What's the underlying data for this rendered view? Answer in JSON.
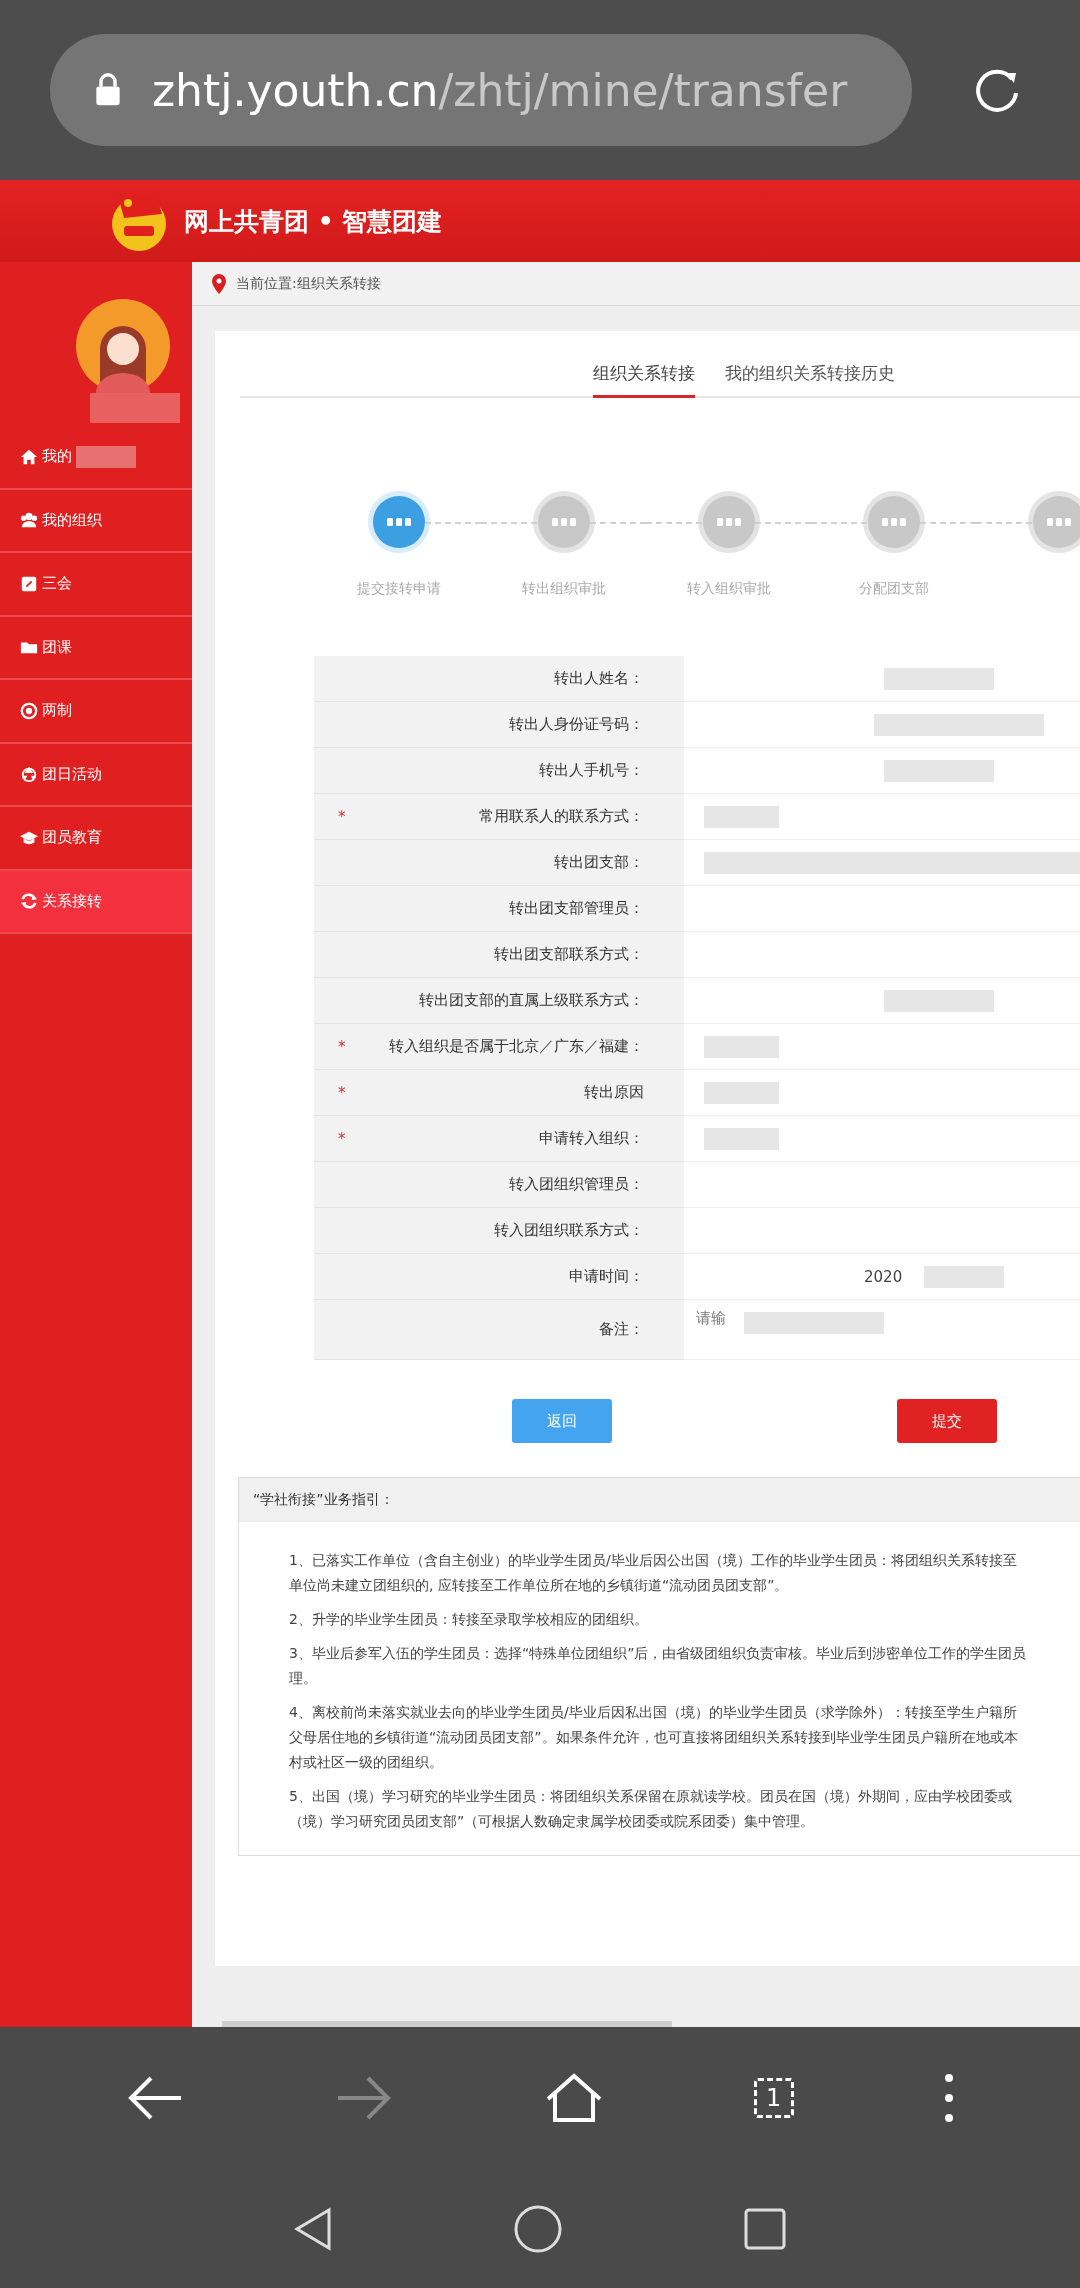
{
  "browser": {
    "url_host": "zhtj.youth.cn",
    "url_path": "/zhtj/mine/transfer",
    "tab_count": "1",
    "forward_disabled": true
  },
  "header": {
    "title": "网上共青团 • 智慧团建"
  },
  "sidebar": {
    "items": [
      {
        "label": "我的",
        "selected": false,
        "blurred": true
      },
      {
        "label": "我的组织",
        "selected": false,
        "blurred": false
      },
      {
        "label": "三会",
        "selected": false,
        "blurred": false
      },
      {
        "label": "团课",
        "selected": false,
        "blurred": false
      },
      {
        "label": "两制",
        "selected": false,
        "blurred": false
      },
      {
        "label": "团日活动",
        "selected": false,
        "blurred": false
      },
      {
        "label": "团员教育",
        "selected": false,
        "blurred": false
      },
      {
        "label": "关系接转",
        "selected": true,
        "blurred": false
      }
    ]
  },
  "breadcrumb": "当前位置:组织关系转接",
  "tabs": [
    {
      "label": "组织关系转接",
      "selected": true
    },
    {
      "label": "我的组织关系转接历史",
      "selected": false
    }
  ],
  "steps": [
    {
      "label": "提交接转申请",
      "active": true
    },
    {
      "label": "转出组织审批",
      "active": false
    },
    {
      "label": "转入组织审批",
      "active": false
    },
    {
      "label": "分配团支部",
      "active": false
    },
    {
      "active": false
    }
  ],
  "form": {
    "rows": [
      {
        "label": "转出人姓名：",
        "blurred": true
      },
      {
        "label": "转出人身份证号码：",
        "blurred": true
      },
      {
        "label": "转出人手机号：",
        "blurred": true
      },
      {
        "mark": "*",
        "label": "常用联系人的联系方式：",
        "blurred": true
      },
      {
        "label": "转出团支部：",
        "blurred": true
      },
      {
        "label": "转出团支部管理员：",
        "blurred": false
      },
      {
        "label": "转出团支部联系方式：",
        "blurred": false
      },
      {
        "label": "转出团支部的直属上级联系方式：",
        "blurred": true
      },
      {
        "mark": "*",
        "label": "转入组织是否属于北京／广东／福建：",
        "blurred": true
      },
      {
        "mark": "*",
        "label": "转出原因",
        "blurred": true
      },
      {
        "mark": "*",
        "label": "申请转入组织：",
        "blurred": true
      },
      {
        "label": "转入团组织管理员：",
        "blurred": false
      },
      {
        "label": "转入团组织联系方式：",
        "blurred": false
      },
      {
        "label": "申请时间：",
        "blurred": true,
        "value": "2020"
      },
      {
        "label": "备注：",
        "blurred": true,
        "placeholder": "请输"
      }
    ]
  },
  "buttons": [
    {
      "label": "返回",
      "kind": "back"
    },
    {
      "label": "提交",
      "kind": "submit"
    }
  ],
  "guide": {
    "title": "“学社衔接”业务指引：",
    "items": [
      {
        "lines": [
          "1、已落实工作单位（含自主创业）的毕业学生团员/毕业后因公出国（境）工作的毕业学生团员：将团组织关系转接至",
          "单位尚未建立团组织的, 应转接至工作单位所在地的乡镇街道“流动团员团支部”。"
        ]
      },
      {
        "lines": [
          "2、升学的毕业学生团员：转接至录取学校相应的团组织。"
        ]
      },
      {
        "lines": [
          "3、毕业后参军入伍的学生团员：选择“特殊单位团组织”后，由省级团组织负责审核。毕业后到涉密单位工作的学生团员",
          "理。"
        ]
      },
      {
        "lines": [
          "4、离校前尚未落实就业去向的毕业学生团员/毕业后因私出国（境）的毕业学生团员（求学除外）：转接至学生户籍所",
          "父母居住地的乡镇街道“流动团员团支部”。如果条件允许，也可直接将团组织关系转接到毕业学生团员户籍所在地或本",
          "村或社区一级的团组织。"
        ]
      },
      {
        "lines": [
          "5、出国（境）学习研究的毕业学生团员：将团组织关系保留在原就读学校。团员在国（境）外期间，应由学校团委或",
          "（境）学习研究团员团支部”（可根据人数确定隶属学校团委或院系团委）集中管理。"
        ]
      }
    ]
  }
}
